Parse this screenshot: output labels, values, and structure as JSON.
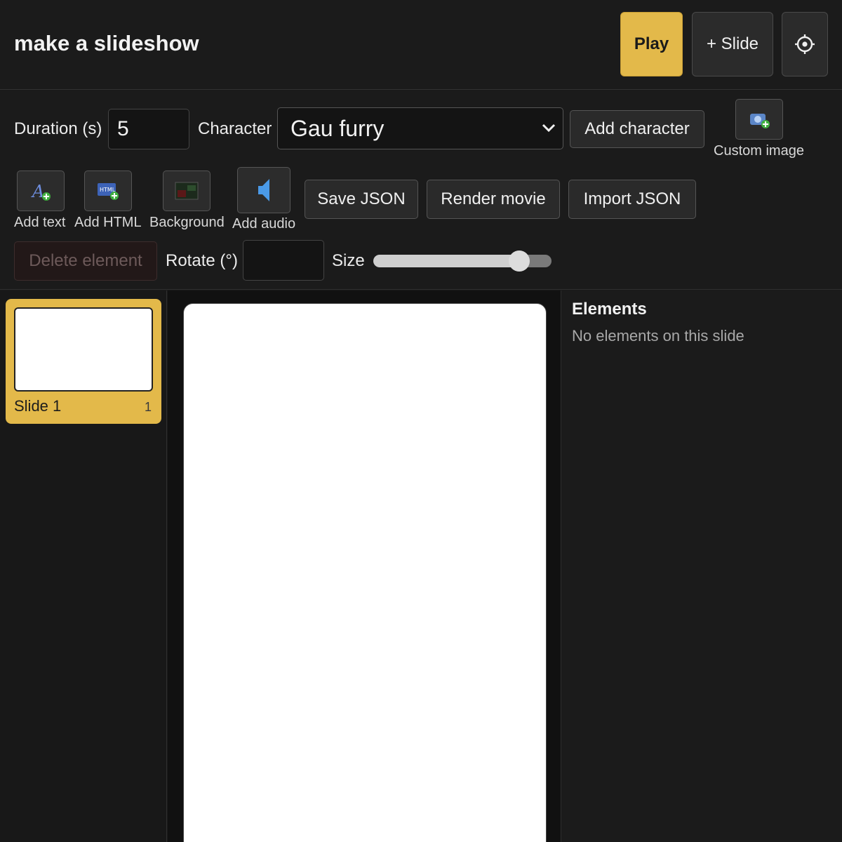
{
  "header": {
    "title": "make a slideshow",
    "play_label": "Play",
    "add_slide_label": "+ Slide",
    "settings_icon": "gear-icon"
  },
  "toolbar": {
    "duration_label": "Duration (s)",
    "duration_value": "5",
    "character_label": "Character",
    "character_selected": "Gau furry",
    "add_character_label": "Add character",
    "custom_image_label": "Custom image",
    "add_text_label": "Add text",
    "add_html_label": "Add HTML",
    "background_label": "Background",
    "add_audio_label": "Add audio",
    "save_json_label": "Save JSON",
    "render_movie_label": "Render movie",
    "import_json_label": "Import JSON",
    "delete_element_label": "Delete element",
    "rotate_label": "Rotate (°)",
    "rotate_value": "",
    "size_label": "Size",
    "size_value": 0.82
  },
  "slides": [
    {
      "name": "Slide 1",
      "number": "1",
      "selected": true
    }
  ],
  "elements_panel": {
    "title": "Elements",
    "empty_text": "No elements on this slide"
  },
  "colors": {
    "accent": "#e3b94a",
    "background": "#1a1a1a",
    "canvas": "#ffffff"
  }
}
